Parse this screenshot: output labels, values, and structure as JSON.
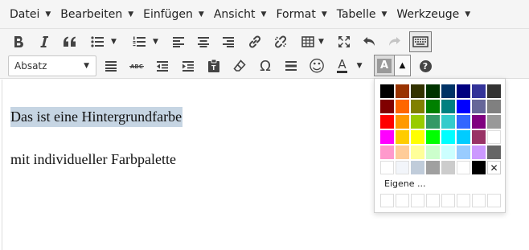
{
  "menubar": {
    "items": [
      {
        "label": "Datei"
      },
      {
        "label": "Bearbeiten"
      },
      {
        "label": "Einfügen"
      },
      {
        "label": "Ansicht"
      },
      {
        "label": "Format"
      },
      {
        "label": "Tabelle"
      },
      {
        "label": "Werkzeuge"
      }
    ]
  },
  "toolbar": {
    "format_select": {
      "value": "Absatz"
    },
    "special_char_glyph": "Ω",
    "emoticon_glyph": "☺",
    "text_color_letter": "A",
    "bg_color_letter": "A",
    "bg_color_dropdown_glyph": "▲",
    "help_glyph": "?"
  },
  "editor": {
    "line1": "Das ist eine Hintergrundfarbe",
    "line2": "mit individueller Farbpalette",
    "highlight_color": "#c6d5e3"
  },
  "color_picker": {
    "colors": [
      "#000000",
      "#993300",
      "#333300",
      "#003300",
      "#003366",
      "#000080",
      "#333399",
      "#333333",
      "#800000",
      "#FF6600",
      "#808000",
      "#008000",
      "#008080",
      "#0000FF",
      "#666699",
      "#808080",
      "#FF0000",
      "#FF9900",
      "#99CC00",
      "#339966",
      "#33CCCC",
      "#3366FF",
      "#800080",
      "#999999",
      "#FF00FF",
      "#FFCC00",
      "#FFFF00",
      "#00FF00",
      "#00FFFF",
      "#00CCFF",
      "#993366",
      "#FFFFFF",
      "#FF99CC",
      "#FFCC99",
      "#FFFF99",
      "#CCFFCC",
      "#CCFFFF",
      "#99CCFF",
      "#CC99FF",
      "#666666",
      "#FFFFFF",
      "#F2F5FA",
      "#C0CCDA",
      "#A0A0A0",
      "#CCCCCC",
      "#FFFFFF",
      "#000000"
    ],
    "remove_glyph": "✕",
    "custom_label": "Eigene ..."
  }
}
